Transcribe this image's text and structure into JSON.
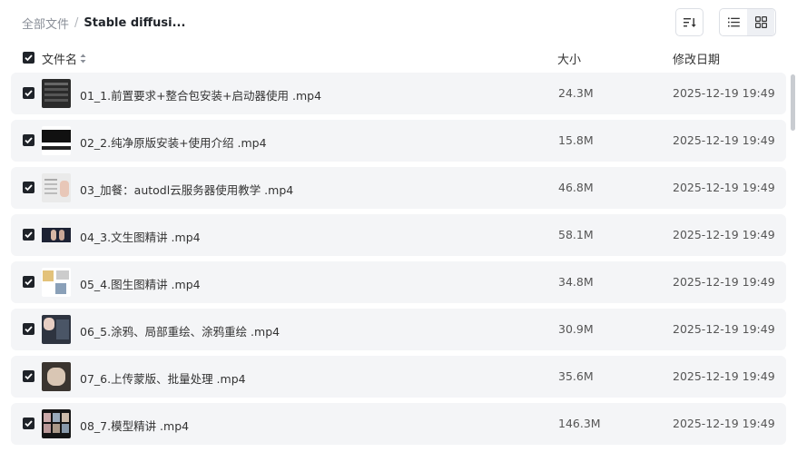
{
  "breadcrumb": {
    "root": "全部文件",
    "separator": "/",
    "current": "Stable diffusi..."
  },
  "toolbar": {
    "sort_icon": "sort-lines-icon",
    "list_icon": "list-view-icon",
    "grid_icon": "grid-view-icon",
    "active_view": "list"
  },
  "columns": {
    "name": "文件名",
    "size": "大小",
    "date": "修改日期"
  },
  "files": [
    {
      "name": "01_1.前置要求+整合包安装+启动器使用 .mp4",
      "size": "24.3M",
      "date": "2025-12-19 19:49",
      "checked": true
    },
    {
      "name": "02_2.纯净原版安装+使用介绍 .mp4",
      "size": "15.8M",
      "date": "2025-12-19 19:49",
      "checked": true
    },
    {
      "name": "03_加餐：autodl云服务器使用教学 .mp4",
      "size": "46.8M",
      "date": "2025-12-19 19:49",
      "checked": true
    },
    {
      "name": "04_3.文生图精讲 .mp4",
      "size": "58.1M",
      "date": "2025-12-19 19:49",
      "checked": true
    },
    {
      "name": "05_4.图生图精讲 .mp4",
      "size": "34.8M",
      "date": "2025-12-19 19:49",
      "checked": true
    },
    {
      "name": "06_5.涂鸦、局部重绘、涂鸦重绘 .mp4",
      "size": "30.9M",
      "date": "2025-12-19 19:49",
      "checked": true
    },
    {
      "name": "07_6.上传蒙版、批量处理 .mp4",
      "size": "35.6M",
      "date": "2025-12-19 19:49",
      "checked": true
    },
    {
      "name": "08_7.模型精讲 .mp4",
      "size": "146.3M",
      "date": "2025-12-19 19:49",
      "checked": true
    }
  ]
}
